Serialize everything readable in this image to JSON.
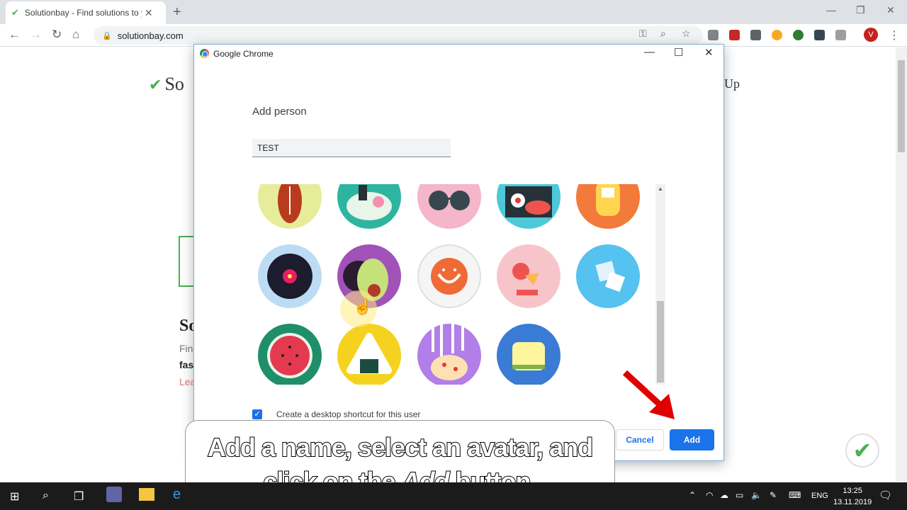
{
  "browser": {
    "tab_title": "Solutionbay - Find solutions to y",
    "tab_close": "✕",
    "new_tab": "+",
    "url": "solutionbay.com",
    "profile_initial": "V",
    "window_controls": {
      "minimize": "—",
      "restore": "❐",
      "close": "✕"
    }
  },
  "background_page": {
    "logo_text": "So",
    "signup_text": "Up",
    "section_letter": "So",
    "line1": "Fin",
    "line2": "fas",
    "line3": "Lea"
  },
  "dialog": {
    "title": "Google Chrome",
    "controls": {
      "minimize": "—",
      "maximize": "☐",
      "close": "✕"
    },
    "heading": "Add person",
    "name_value": "TEST",
    "avatars": [
      {
        "name": "football-avatar"
      },
      {
        "name": "noodle-bowl-avatar"
      },
      {
        "name": "sunglasses-avatar"
      },
      {
        "name": "sushi-avatar"
      },
      {
        "name": "game-device-avatar"
      },
      {
        "name": "vinyl-record-avatar"
      },
      {
        "name": "avocado-avatar"
      },
      {
        "name": "smile-avatar"
      },
      {
        "name": "ice-cream-avatar"
      },
      {
        "name": "sugar-cubes-avatar"
      },
      {
        "name": "watermelon-avatar"
      },
      {
        "name": "onigiri-avatar"
      },
      {
        "name": "pizza-avatar"
      },
      {
        "name": "sandwich-avatar"
      }
    ],
    "shortcut_checked": true,
    "shortcut_label": "Create a desktop shortcut for this user",
    "cancel_label": "Cancel",
    "add_label": "Add"
  },
  "caption": {
    "line1": "Add a name, select an avatar, and",
    "line2_pre": "click on the ",
    "line2_em": "Add",
    "line2_post": " button."
  },
  "taskbar": {
    "language": "ENG",
    "time": "13:25",
    "date": "13.11.2019"
  },
  "colors": {
    "accent": "#1a73e8",
    "arrow": "#e00000",
    "taskbar": "#1b1b1b"
  }
}
